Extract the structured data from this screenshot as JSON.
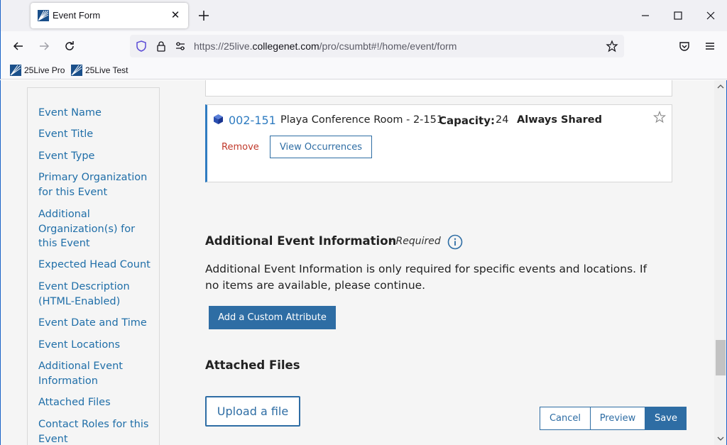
{
  "browser": {
    "tab_title": "Event Form",
    "url_prefix": "https://25live.",
    "url_domain": "collegenet.com",
    "url_path": "/pro/csumbt#!/home/event/form",
    "bookmarks": [
      "25Live Pro",
      "25Live Test"
    ]
  },
  "sidebar": {
    "items": [
      "Event Name",
      "Event Title",
      "Event Type",
      "Primary Organization for this Event",
      "Additional Organization(s) for this Event",
      "Expected Head Count",
      "Event Description (HTML-Enabled)",
      "Event Date and Time",
      "Event Locations",
      "Additional Event Information",
      "Attached Files",
      "Contact Roles for this Event"
    ]
  },
  "location": {
    "code": "002-151",
    "name": "Playa Conference Room - 2-151",
    "capacity_label": "Capacity:",
    "capacity_value": "24",
    "shared": "Always Shared",
    "remove_label": "Remove",
    "view_label": "View Occurrences"
  },
  "additional_info": {
    "title": "Additional Event Information",
    "required": "- Required",
    "description": "Additional Event Information is only required for specific events and locations. If no items are available, please continue.",
    "button": "Add a Custom Attribute"
  },
  "attached_files": {
    "title": "Attached Files",
    "upload_label": "Upload a file"
  },
  "footer": {
    "cancel": "Cancel",
    "preview": "Preview",
    "save": "Save"
  },
  "colors": {
    "link": "#1f6ea8",
    "primary": "#2e6da4",
    "remove": "#c0392b"
  }
}
